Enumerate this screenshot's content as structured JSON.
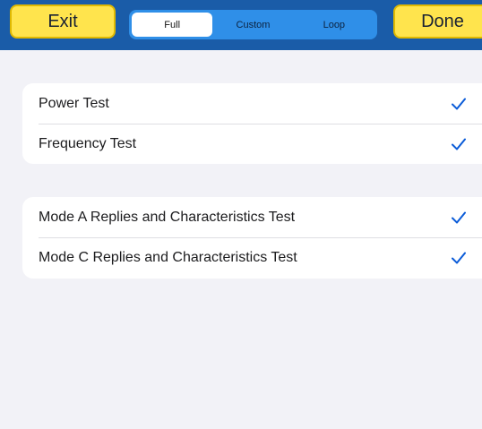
{
  "toolbar": {
    "exit_label": "Exit",
    "done_label": "Done",
    "segments": [
      "Full",
      "Custom",
      "Loop"
    ],
    "selected_segment": "Full"
  },
  "groups": [
    {
      "items": [
        {
          "label": "Power Test",
          "checked": true
        },
        {
          "label": "Frequency Test",
          "checked": true
        }
      ]
    },
    {
      "items": [
        {
          "label": "Mode A Replies and Characteristics Test",
          "checked": true
        },
        {
          "label": "Mode C Replies and Characteristics Test",
          "checked": true
        }
      ]
    }
  ],
  "colors": {
    "header": "#1a5ca8",
    "button_yellow": "#ffe44d",
    "segment_blue": "#2f8fe8",
    "check_blue": "#0a5bd8",
    "background": "#f2f2f7"
  }
}
